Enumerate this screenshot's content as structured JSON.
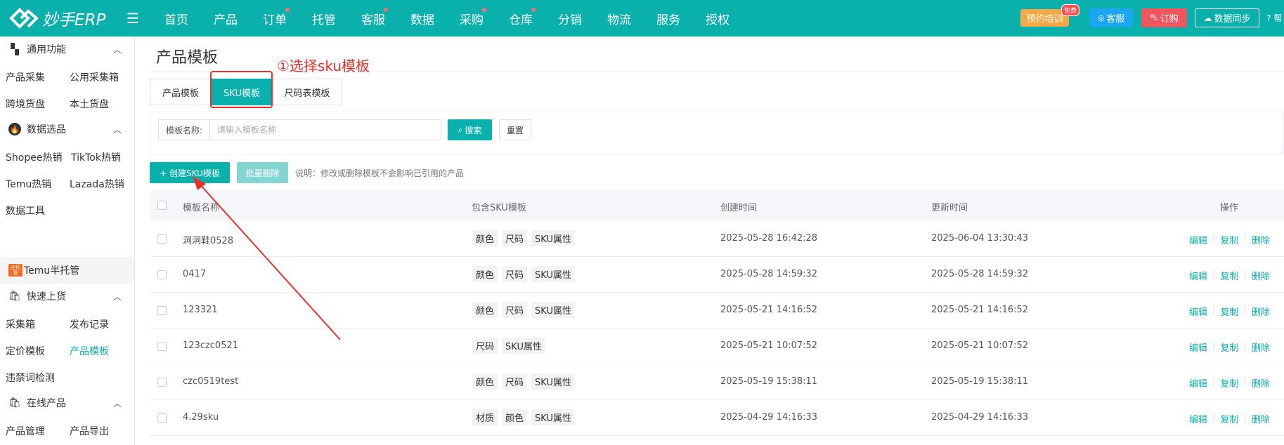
{
  "app": {
    "logo_text": "妙手ERP",
    "nav": [
      {
        "label": "首页",
        "dot": false
      },
      {
        "label": "产品",
        "dot": false
      },
      {
        "label": "订单",
        "dot": true
      },
      {
        "label": "托管",
        "dot": false
      },
      {
        "label": "客服",
        "dot": true
      },
      {
        "label": "数据",
        "dot": false
      },
      {
        "label": "采购",
        "dot": true
      },
      {
        "label": "仓库",
        "dot": true
      },
      {
        "label": "分销",
        "dot": false
      },
      {
        "label": "物流",
        "dot": false
      },
      {
        "label": "服务",
        "dot": false
      },
      {
        "label": "授权",
        "dot": false
      }
    ],
    "training_label": "预约培训",
    "training_badge": "免费",
    "service_label": "客服",
    "order_label": "订购",
    "sync_label": "数据同步",
    "help_label": "帮"
  },
  "sidebar": {
    "groups": [
      {
        "label": "通用功能",
        "icon": "grid-icon"
      },
      {
        "label": "数据选品",
        "icon": "fire-icon"
      },
      {
        "label": "快速上货",
        "icon": "bag-icon"
      },
      {
        "label": "在线产品",
        "icon": "bag-icon"
      }
    ],
    "items": {
      "collect": "产品采集",
      "public_box": "公用采集箱",
      "cross_goods": "跨境货盘",
      "local_goods": "本土货盘",
      "shopee_hot": "Shopee热销",
      "tiktok_hot": "TikTok热销",
      "temu_hot": "Temu热销",
      "lazada_hot": "Lazada热销",
      "data_tools": "数据工具",
      "temu_semi": "Temu半托管",
      "temu_badge": "全托管 TEMU",
      "collect_box": "采集箱",
      "publish_log": "发布记录",
      "pricing_tpl": "定价模板",
      "product_tpl": "产品模板",
      "banned_words": "违禁词检测",
      "product_mgmt": "产品管理",
      "product_export": "产品导出"
    }
  },
  "main": {
    "title": "产品模板",
    "tabs": [
      "产品模板",
      "SKU模板",
      "尺码表模板"
    ],
    "annotation": "①选择sku模板",
    "search": {
      "label": "模板名称:",
      "placeholder": "请输入模板名称",
      "search_btn": "搜索",
      "reset_btn": "重置"
    },
    "create_btn": "+ 创建SKU模板",
    "batch_delete_btn": "批量删除",
    "note": "说明：修改或删除模板不会影响已引用的产品"
  },
  "table": {
    "columns": [
      "模板名称",
      "包含SKU模板",
      "创建时间",
      "更新时间",
      "操作"
    ],
    "actions": [
      "编辑",
      "复制",
      "删除"
    ],
    "rows": [
      {
        "name": "洞洞鞋0528",
        "tags": [
          "颜色",
          "尺码",
          "SKU属性"
        ],
        "created": "2025-05-28 16:42:28",
        "updated": "2025-06-04 13:30:43"
      },
      {
        "name": "0417",
        "tags": [
          "颜色",
          "尺码",
          "SKU属性"
        ],
        "created": "2025-05-28 14:59:32",
        "updated": "2025-05-28 14:59:32"
      },
      {
        "name": "123321",
        "tags": [
          "颜色",
          "尺码",
          "SKU属性"
        ],
        "created": "2025-05-21 14:16:52",
        "updated": "2025-05-21 14:16:52"
      },
      {
        "name": "123czc0521",
        "tags": [
          "尺码",
          "SKU属性"
        ],
        "created": "2025-05-21 10:07:52",
        "updated": "2025-05-21 10:07:52"
      },
      {
        "name": "czc0519test",
        "tags": [
          "颜色",
          "尺码",
          "SKU属性"
        ],
        "created": "2025-05-19 15:38:11",
        "updated": "2025-05-19 15:38:11"
      },
      {
        "name": "4.29sku",
        "tags": [
          "材质",
          "颜色",
          "SKU属性"
        ],
        "created": "2025-04-29 14:16:33",
        "updated": "2025-04-29 14:16:33"
      }
    ]
  },
  "colors": {
    "primary": "#09b0ac",
    "annotation": "#e8302b"
  }
}
